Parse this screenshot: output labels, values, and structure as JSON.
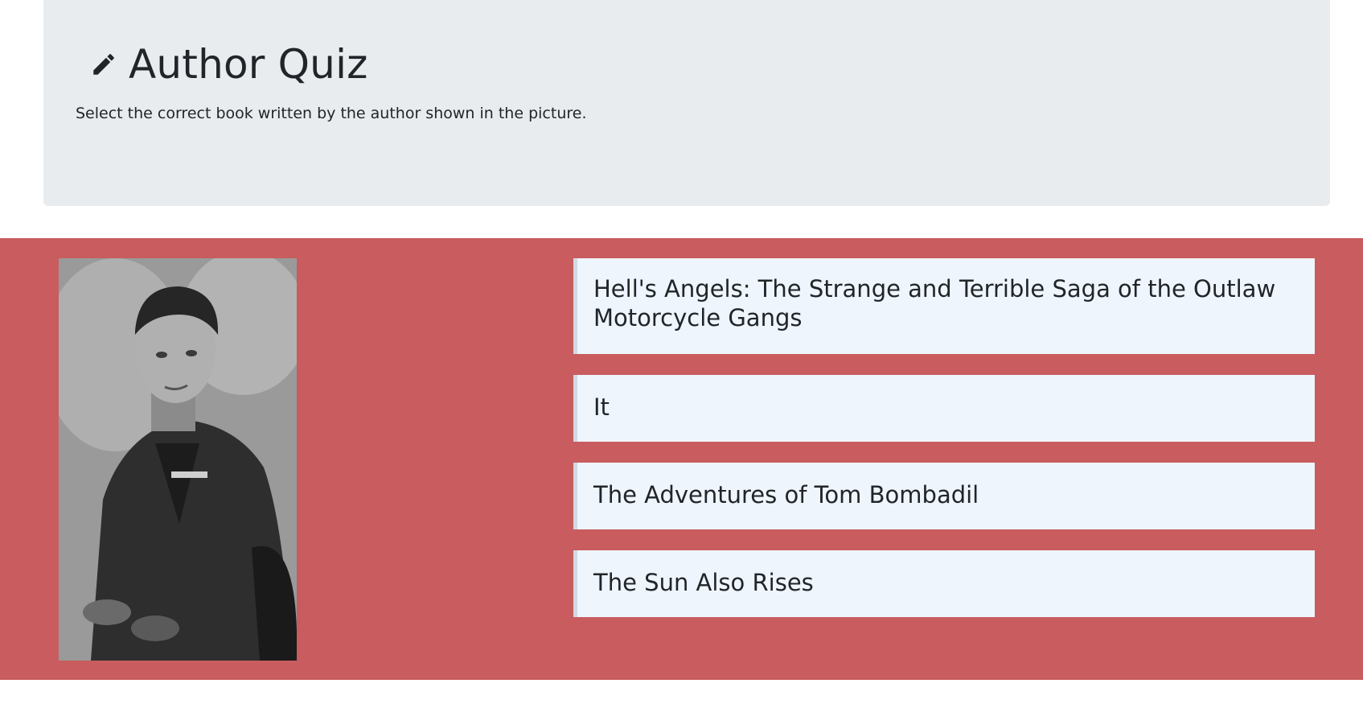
{
  "header": {
    "title": "Author Quiz",
    "subtitle": "Select the correct book written by the author shown in the picture.",
    "icon": "pencil-icon"
  },
  "quiz": {
    "band_color": "#c95c5e",
    "answers": [
      "Hell's Angels: The Strange and Terrible Saga of the Outlaw Motorcycle Gangs",
      "It",
      "The Adventures of Tom Bombadil",
      "The Sun Also Rises"
    ]
  },
  "colors": {
    "jumbotron": "#e9ecef",
    "answer_bg": "#eef5fc",
    "text": "#212529"
  }
}
